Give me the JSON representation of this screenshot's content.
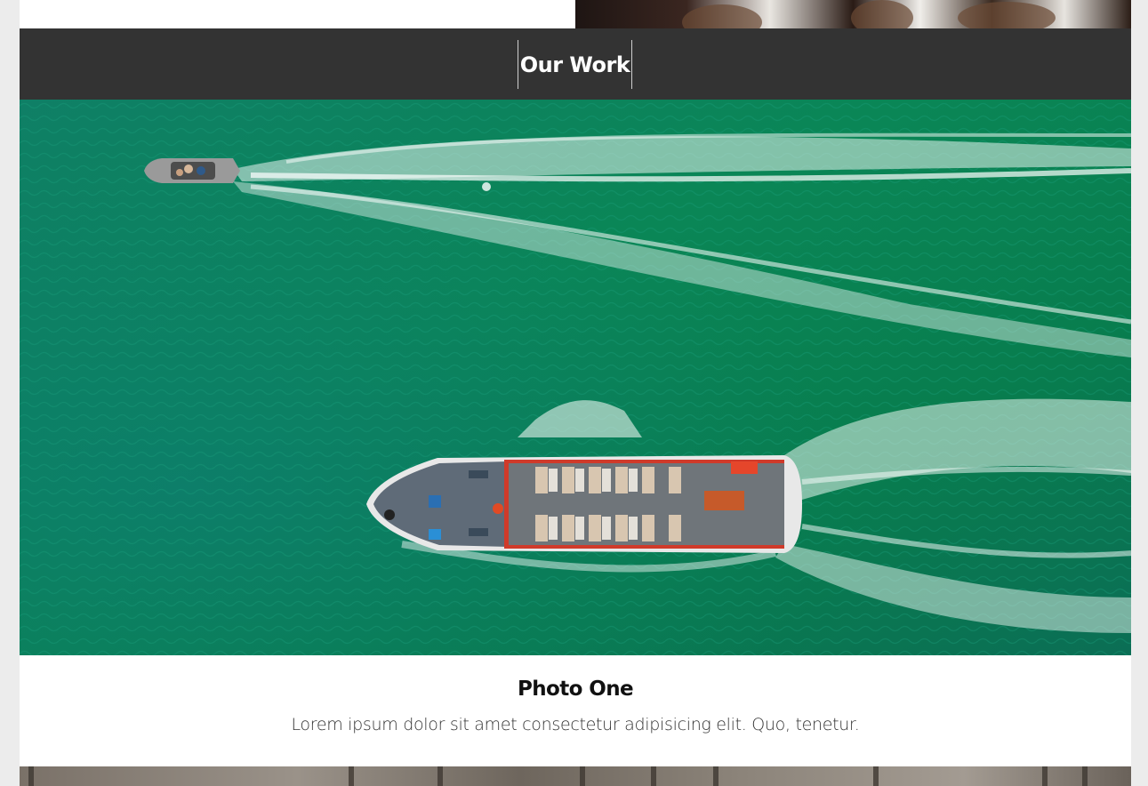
{
  "section": {
    "title": "Our Work"
  },
  "gallery": {
    "items": [
      {
        "title": "Photo One",
        "description": "Lorem ipsum dolor sit amet consectetur adipisicing elit. Quo, tenetur."
      }
    ]
  },
  "colors": {
    "header_bar": "#333333",
    "page_background": "#ececec",
    "card_background": "#ffffff",
    "water": "#0d8a5c"
  }
}
